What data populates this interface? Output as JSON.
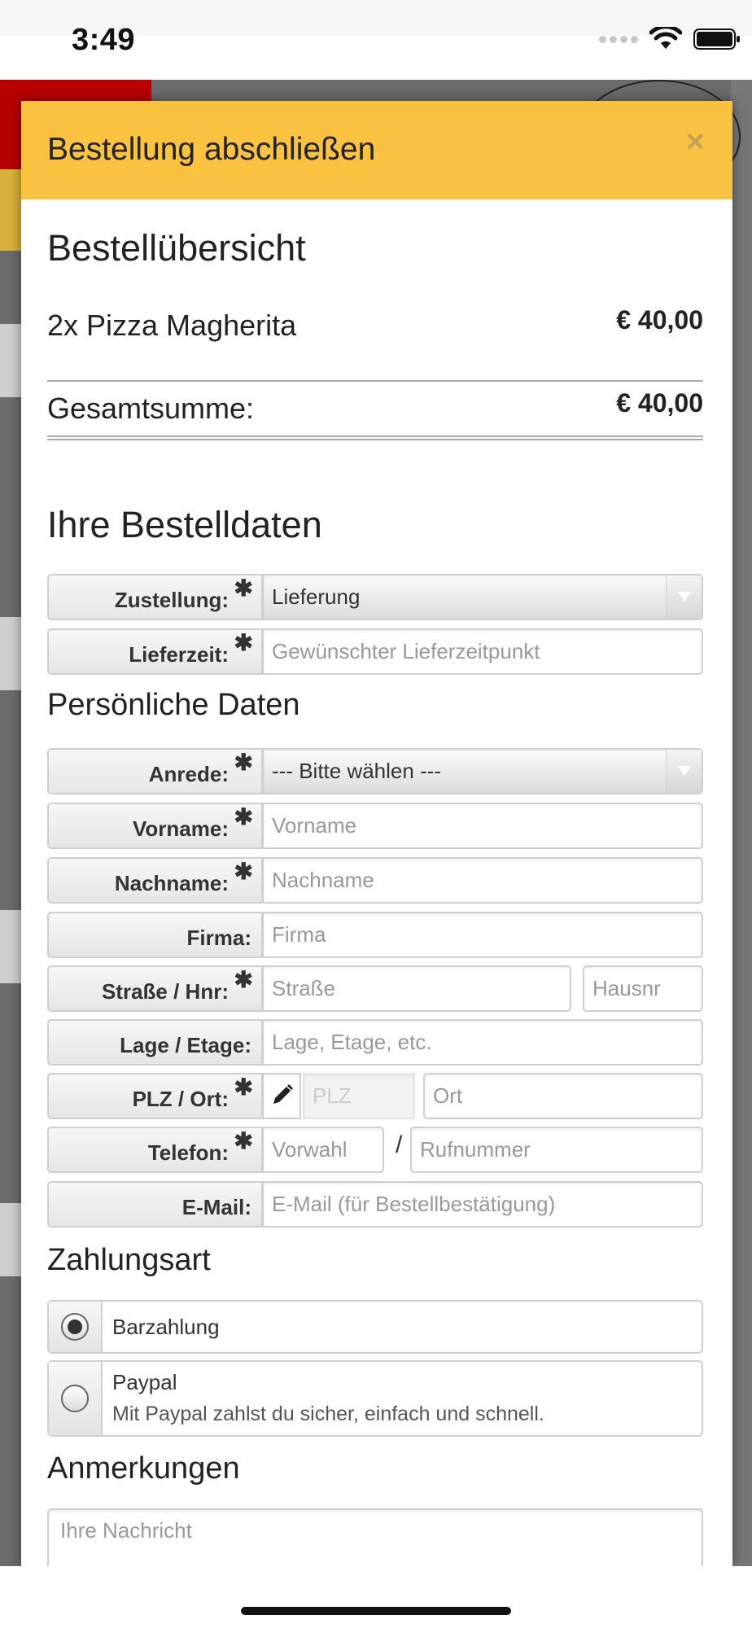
{
  "statusbar": {
    "time": "3:49",
    "icons": [
      "signal-dots-icon",
      "wifi-icon",
      "battery-icon"
    ]
  },
  "modal": {
    "title": "Bestellung abschließen",
    "close_label": "×"
  },
  "summary": {
    "heading": "Bestellübersicht",
    "items": [
      {
        "label": "2x Pizza Magherita",
        "price": "€ 40,00"
      }
    ],
    "total_label": "Gesamtsumme:",
    "total_value": "€ 40,00"
  },
  "order_data": {
    "heading": "Ihre Bestelldaten",
    "zustellung": {
      "label": "Zustellung:",
      "value": "Lieferung"
    },
    "lieferzeit": {
      "label": "Lieferzeit:",
      "placeholder": "Gewünschter Lieferzeitpunkt"
    }
  },
  "personal": {
    "heading": "Persönliche Daten",
    "anrede": {
      "label": "Anrede:",
      "value": "--- Bitte wählen ---"
    },
    "vorname": {
      "label": "Vorname:",
      "placeholder": "Vorname"
    },
    "nachname": {
      "label": "Nachname:",
      "placeholder": "Nachname"
    },
    "firma": {
      "label": "Firma:",
      "placeholder": "Firma"
    },
    "strasse": {
      "label": "Straße / Hnr:",
      "placeholder_street": "Straße",
      "placeholder_number": "Hausnr"
    },
    "lage": {
      "label": "Lage / Etage:",
      "placeholder": "Lage, Etage, etc."
    },
    "plz": {
      "label": "PLZ / Ort:",
      "placeholder_plz": "PLZ",
      "placeholder_ort": "Ort"
    },
    "telefon": {
      "label": "Telefon:",
      "placeholder_vorwahl": "Vorwahl",
      "separator": "/",
      "placeholder_nummer": "Rufnummer"
    },
    "email": {
      "label": "E-Mail:",
      "placeholder": "E-Mail (für Bestellbestätigung)"
    },
    "required_mark": "✱"
  },
  "payment": {
    "heading": "Zahlungsart",
    "options": [
      {
        "title": "Barzahlung",
        "description": "",
        "selected": true
      },
      {
        "title": "Paypal",
        "description": "Mit Paypal zahlst du sicher, einfach und schnell.",
        "selected": false
      }
    ]
  },
  "notes": {
    "heading": "Anmerkungen",
    "placeholder": "Ihre Nachricht"
  }
}
